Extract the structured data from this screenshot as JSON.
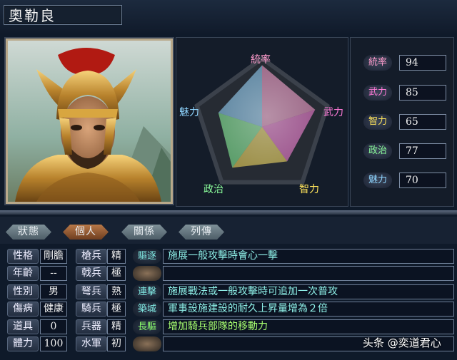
{
  "officer": {
    "name": "奧勒良"
  },
  "radar": {
    "labels": [
      "統率",
      "武力",
      "智力",
      "政治",
      "魅力"
    ],
    "label_colors": [
      "#ff9ccd",
      "#ff7ad8",
      "#ffe45c",
      "#8cff9c",
      "#8fd5ff"
    ]
  },
  "stats": [
    {
      "label": "統率",
      "value": "94",
      "color": "#ff9ccd",
      "score": 94
    },
    {
      "label": "武力",
      "value": "85",
      "color": "#ff7ad8",
      "score": 85
    },
    {
      "label": "智力",
      "value": "65",
      "color": "#ffe45c",
      "score": 65
    },
    {
      "label": "政治",
      "value": "77",
      "color": "#8cff9c",
      "score": 77
    },
    {
      "label": "魅力",
      "value": "70",
      "color": "#8fd5ff",
      "score": 70
    }
  ],
  "tabs": [
    {
      "label": "狀態",
      "active": false
    },
    {
      "label": "個人",
      "active": true
    },
    {
      "label": "關係",
      "active": false
    },
    {
      "label": "列傳",
      "active": false
    }
  ],
  "personal": [
    {
      "label": "性格",
      "value": "剛膽"
    },
    {
      "label": "年齡",
      "value": "--"
    },
    {
      "label": "性別",
      "value": "男"
    },
    {
      "label": "傷病",
      "value": "健康"
    },
    {
      "label": "道具",
      "value": "0"
    },
    {
      "label": "體力",
      "value": "100"
    }
  ],
  "aptitude": [
    {
      "label": "槍兵",
      "grade": "精"
    },
    {
      "label": "戟兵",
      "grade": "極"
    },
    {
      "label": "弩兵",
      "grade": "熟"
    },
    {
      "label": "騎兵",
      "grade": "極"
    },
    {
      "label": "兵器",
      "grade": "精"
    },
    {
      "label": "水軍",
      "grade": "初"
    }
  ],
  "skills": [
    {
      "tag": "驅逐",
      "color": "#7fe6e0",
      "desc": "施展一般攻擊時會心一擊",
      "desc_color": "#8ff0e8"
    },
    {
      "tag": "",
      "color": "",
      "desc": "",
      "desc_color": ""
    },
    {
      "tag": "連擊",
      "color": "#7fe6e0",
      "desc": "施展戰法或一般攻擊時可追加一次普攻",
      "desc_color": "#8ff0e8"
    },
    {
      "tag": "築城",
      "color": "#7fe6e0",
      "desc": "軍事設施建設的耐久上昇量增為２倍",
      "desc_color": "#8ff0e8"
    },
    {
      "tag": "長驅",
      "color": "#8cff6c",
      "desc": "增加騎兵部隊的移動力",
      "desc_color": "#a8ff70"
    },
    {
      "tag": "",
      "color": "",
      "desc": "",
      "desc_color": ""
    }
  ],
  "watermark": "头条 @奕道君心"
}
